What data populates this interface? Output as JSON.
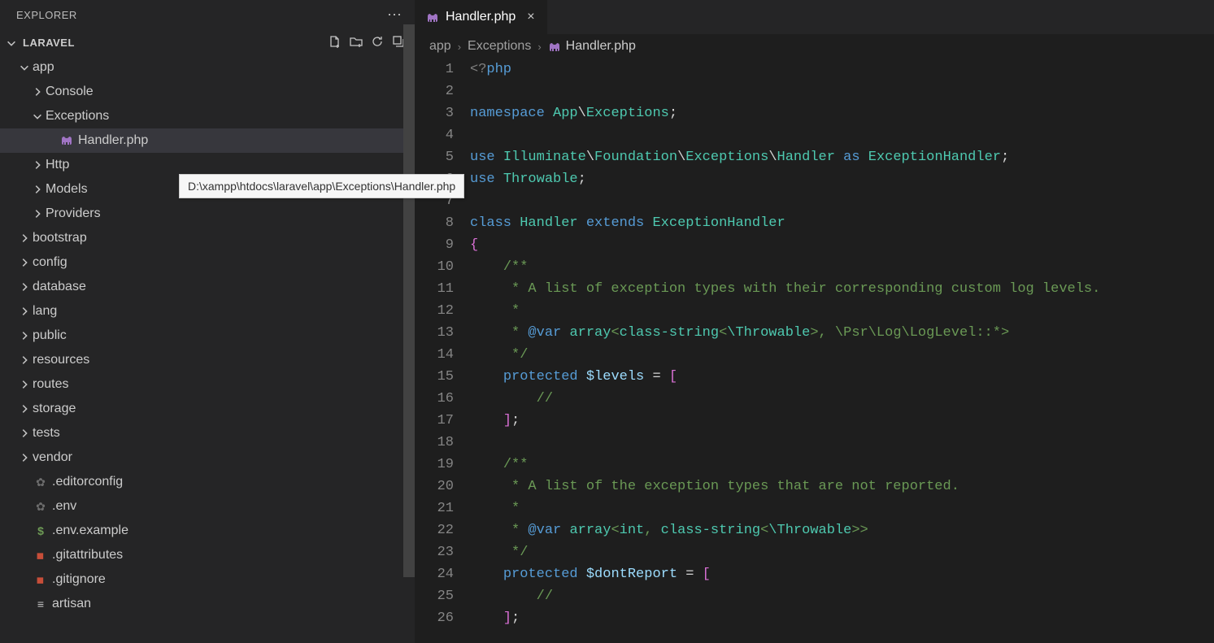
{
  "explorer": {
    "title": "EXPLORER",
    "more_icon": "⋯",
    "project_name": "LARAVEL",
    "actions": {
      "new_file": "new-file",
      "new_folder": "new-folder",
      "refresh": "refresh",
      "collapse": "collapse-all"
    }
  },
  "tree": [
    {
      "depth": 1,
      "kind": "folder",
      "open": true,
      "label": "app"
    },
    {
      "depth": 2,
      "kind": "folder",
      "open": false,
      "label": "Console"
    },
    {
      "depth": 2,
      "kind": "folder",
      "open": true,
      "label": "Exceptions"
    },
    {
      "depth": 3,
      "kind": "file-php",
      "label": "Handler.php",
      "selected": true
    },
    {
      "depth": 2,
      "kind": "folder",
      "open": false,
      "label": "Http"
    },
    {
      "depth": 2,
      "kind": "folder",
      "open": false,
      "label": "Models"
    },
    {
      "depth": 2,
      "kind": "folder",
      "open": false,
      "label": "Providers"
    },
    {
      "depth": 1,
      "kind": "folder",
      "open": false,
      "label": "bootstrap"
    },
    {
      "depth": 1,
      "kind": "folder",
      "open": false,
      "label": "config"
    },
    {
      "depth": 1,
      "kind": "folder",
      "open": false,
      "label": "database"
    },
    {
      "depth": 1,
      "kind": "folder",
      "open": false,
      "label": "lang"
    },
    {
      "depth": 1,
      "kind": "folder",
      "open": false,
      "label": "public"
    },
    {
      "depth": 1,
      "kind": "folder",
      "open": false,
      "label": "resources"
    },
    {
      "depth": 1,
      "kind": "folder",
      "open": false,
      "label": "routes"
    },
    {
      "depth": 1,
      "kind": "folder",
      "open": false,
      "label": "storage"
    },
    {
      "depth": 1,
      "kind": "folder",
      "open": false,
      "label": "tests"
    },
    {
      "depth": 1,
      "kind": "folder",
      "open": false,
      "label": "vendor"
    },
    {
      "depth": 1,
      "kind": "file-gear",
      "label": ".editorconfig"
    },
    {
      "depth": 1,
      "kind": "file-gear",
      "label": ".env"
    },
    {
      "depth": 1,
      "kind": "file-dollar",
      "label": ".env.example"
    },
    {
      "depth": 1,
      "kind": "file-red",
      "label": ".gitattributes"
    },
    {
      "depth": 1,
      "kind": "file-red",
      "label": ".gitignore"
    },
    {
      "depth": 1,
      "kind": "file-lines",
      "label": "artisan"
    }
  ],
  "tooltip": "D:\\xampp\\htdocs\\laravel\\app\\Exceptions\\Handler.php",
  "tab": {
    "label": "Handler.php"
  },
  "breadcrumb": {
    "seg1": "app",
    "seg2": "Exceptions",
    "seg3": "Handler.php"
  },
  "code": {
    "line_start": 1,
    "line_end": 26,
    "highlight_line": 6,
    "lines": [
      [
        {
          "t": "tag",
          "v": "<?"
        },
        {
          "t": "keyword",
          "v": "php"
        }
      ],
      [],
      [
        {
          "t": "keyword",
          "v": "namespace"
        },
        {
          "t": "punct",
          "v": " "
        },
        {
          "t": "ns",
          "v": "App"
        },
        {
          "t": "punct",
          "v": "\\"
        },
        {
          "t": "ns",
          "v": "Exceptions"
        },
        {
          "t": "punct",
          "v": ";"
        }
      ],
      [],
      [
        {
          "t": "keyword",
          "v": "use"
        },
        {
          "t": "punct",
          "v": " "
        },
        {
          "t": "ns",
          "v": "Illuminate"
        },
        {
          "t": "punct",
          "v": "\\"
        },
        {
          "t": "ns",
          "v": "Foundation"
        },
        {
          "t": "punct",
          "v": "\\"
        },
        {
          "t": "ns",
          "v": "Exceptions"
        },
        {
          "t": "punct",
          "v": "\\"
        },
        {
          "t": "class",
          "v": "Handler"
        },
        {
          "t": "punct",
          "v": " "
        },
        {
          "t": "keyword",
          "v": "as"
        },
        {
          "t": "punct",
          "v": " "
        },
        {
          "t": "ns",
          "v": "ExceptionHandler"
        },
        {
          "t": "punct",
          "v": ";"
        }
      ],
      [
        {
          "t": "keyword",
          "v": "use"
        },
        {
          "t": "punct",
          "v": " "
        },
        {
          "t": "class",
          "v": "Throwable"
        },
        {
          "t": "punct",
          "v": ";"
        }
      ],
      [],
      [
        {
          "t": "keyword",
          "v": "class"
        },
        {
          "t": "punct",
          "v": " "
        },
        {
          "t": "class",
          "v": "Handler"
        },
        {
          "t": "punct",
          "v": " "
        },
        {
          "t": "keyword",
          "v": "extends"
        },
        {
          "t": "punct",
          "v": " "
        },
        {
          "t": "class",
          "v": "ExceptionHandler"
        }
      ],
      [
        {
          "t": "curly",
          "v": "{"
        }
      ],
      [
        {
          "t": "punct",
          "v": "    "
        },
        {
          "t": "comment",
          "v": "/**"
        }
      ],
      [
        {
          "t": "punct",
          "v": "    "
        },
        {
          "t": "comment",
          "v": " * A list of exception types with their corresponding custom log levels."
        }
      ],
      [
        {
          "t": "punct",
          "v": "    "
        },
        {
          "t": "comment",
          "v": " *"
        }
      ],
      [
        {
          "t": "punct",
          "v": "    "
        },
        {
          "t": "comment",
          "v": " * "
        },
        {
          "t": "doc-key",
          "v": "@var"
        },
        {
          "t": "comment",
          "v": " "
        },
        {
          "t": "type",
          "v": "array"
        },
        {
          "t": "comment",
          "v": "<"
        },
        {
          "t": "type",
          "v": "class-string"
        },
        {
          "t": "comment",
          "v": "<"
        },
        {
          "t": "type",
          "v": "\\Throwable"
        },
        {
          "t": "comment",
          "v": ">, \\Psr\\Log\\LogLevel::*>"
        }
      ],
      [
        {
          "t": "punct",
          "v": "    "
        },
        {
          "t": "comment",
          "v": " */"
        }
      ],
      [
        {
          "t": "punct",
          "v": "    "
        },
        {
          "t": "keyword",
          "v": "protected"
        },
        {
          "t": "punct",
          "v": " "
        },
        {
          "t": "var",
          "v": "$levels"
        },
        {
          "t": "punct",
          "v": " = "
        },
        {
          "t": "curly",
          "v": "["
        }
      ],
      [
        {
          "t": "punct",
          "v": "        "
        },
        {
          "t": "comment",
          "v": "//"
        }
      ],
      [
        {
          "t": "punct",
          "v": "    "
        },
        {
          "t": "curly",
          "v": "]"
        },
        {
          "t": "punct",
          "v": ";"
        }
      ],
      [],
      [
        {
          "t": "punct",
          "v": "    "
        },
        {
          "t": "comment",
          "v": "/**"
        }
      ],
      [
        {
          "t": "punct",
          "v": "    "
        },
        {
          "t": "comment",
          "v": " * A list of the exception types that are not reported."
        }
      ],
      [
        {
          "t": "punct",
          "v": "    "
        },
        {
          "t": "comment",
          "v": " *"
        }
      ],
      [
        {
          "t": "punct",
          "v": "    "
        },
        {
          "t": "comment",
          "v": " * "
        },
        {
          "t": "doc-key",
          "v": "@var"
        },
        {
          "t": "comment",
          "v": " "
        },
        {
          "t": "type",
          "v": "array"
        },
        {
          "t": "comment",
          "v": "<"
        },
        {
          "t": "type",
          "v": "int"
        },
        {
          "t": "comment",
          "v": ", "
        },
        {
          "t": "type",
          "v": "class-string"
        },
        {
          "t": "comment",
          "v": "<"
        },
        {
          "t": "type",
          "v": "\\Throwable"
        },
        {
          "t": "comment",
          "v": ">>"
        }
      ],
      [
        {
          "t": "punct",
          "v": "    "
        },
        {
          "t": "comment",
          "v": " */"
        }
      ],
      [
        {
          "t": "punct",
          "v": "    "
        },
        {
          "t": "keyword",
          "v": "protected"
        },
        {
          "t": "punct",
          "v": " "
        },
        {
          "t": "var",
          "v": "$dontReport"
        },
        {
          "t": "punct",
          "v": " = "
        },
        {
          "t": "curly",
          "v": "["
        }
      ],
      [
        {
          "t": "punct",
          "v": "        "
        },
        {
          "t": "comment",
          "v": "//"
        }
      ],
      [
        {
          "t": "punct",
          "v": "    "
        },
        {
          "t": "curly",
          "v": "]"
        },
        {
          "t": "punct",
          "v": ";"
        }
      ]
    ]
  }
}
